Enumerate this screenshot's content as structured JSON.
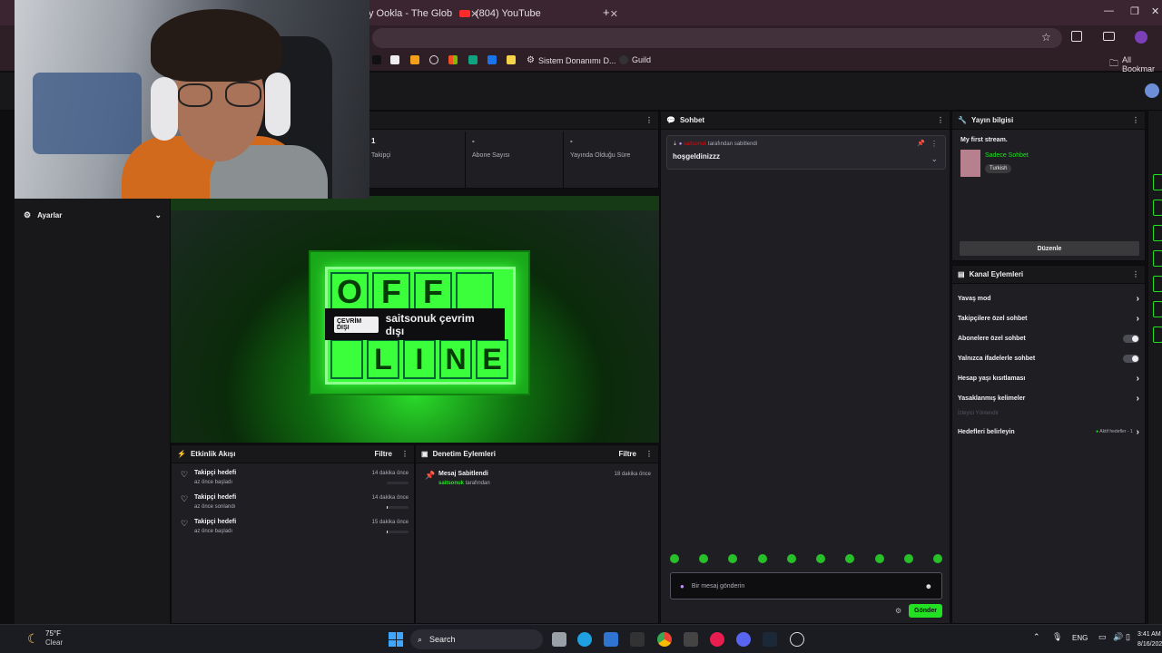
{
  "browser": {
    "tab1": "y Ookla - The Glob",
    "tab2": "(804) YouTube",
    "new_tab": "+",
    "bookmark_sistem": "Sistem Donanımı D...",
    "bookmark_guild": "Guild",
    "all_bookmarks": "All Bookmar"
  },
  "stats": {
    "followers_value": "1",
    "followers_label": "Takipçi",
    "subs_value": "-",
    "subs_label": "Abone Sayısı",
    "live_value": "-",
    "live_label": "Yayında Olduğu Süre"
  },
  "settings_label": "Ayarlar",
  "offline": {
    "tag": "ÇEVRİM DIŞI",
    "message": "saitsonuk çevrim dışı",
    "letters_top": [
      "O",
      "F",
      "F",
      ""
    ],
    "letters_bottom": [
      "",
      "L",
      "I",
      "N",
      "E"
    ]
  },
  "activity": {
    "title": "Etkinlik Akışı",
    "filter": "Filtre",
    "items": [
      {
        "title": "Takipçi hedefi",
        "sub": "az önce başladı",
        "time": "14 dakika önce",
        "progress": 0.0
      },
      {
        "title": "Takipçi hedefi",
        "sub": "az önce sonlandı",
        "time": "14 dakika önce",
        "progress": 0.05
      },
      {
        "title": "Takipçi hedefi",
        "sub": "az önce başladı",
        "time": "15 dakika önce",
        "progress": 0.05
      }
    ]
  },
  "moderation": {
    "title": "Denetim Eylemleri",
    "filter": "Filtre",
    "item_title": "Mesaj Sabitlendi",
    "item_user": "saitsonuk",
    "item_by": "tarafından",
    "item_time": "18 dakika önce"
  },
  "chat": {
    "title": "Sohbet",
    "pinned_user": "saitsonuk",
    "pinned_by": "tarafından sabitlendi",
    "pinned_message": "hoşgeldinizzz",
    "placeholder": "Bir mesaj gönderin",
    "send": "Gönder"
  },
  "stream_info": {
    "title": "Yayın bilgisi",
    "stream_title": "My first stream.",
    "category": "Sadece Sohbet",
    "tag": "Turkish",
    "edit": "Düzenle"
  },
  "channel_actions": {
    "title": "Kanal Eylemleri",
    "items": [
      {
        "label": "Yavaş mod",
        "control": "arrow"
      },
      {
        "label": "Takipçilere özel sohbet",
        "control": "arrow"
      },
      {
        "label": "Abonelere özel sohbet",
        "control": "toggle"
      },
      {
        "label": "Yalnızca ifadelerle sohbet",
        "control": "toggle"
      },
      {
        "label": "Hesap yaşı kısıtlaması",
        "control": "arrow"
      },
      {
        "label": "Yasaklanmış kelimeler",
        "control": "arrow"
      }
    ],
    "section": "İzleyici Yönlendir",
    "goals_label": "Hedefleri belirleyin",
    "goals_status": "Aktif hedefler - 1"
  },
  "taskbar": {
    "temp": "75°F",
    "weather": "Clear",
    "search": "Search",
    "lang": "ENG",
    "time": "3:41 AM",
    "date": "8/16/202"
  },
  "colors": {
    "accent_green": "#22e022",
    "twitch_bg": "#18181b",
    "panel_bg": "#1f1f23"
  }
}
